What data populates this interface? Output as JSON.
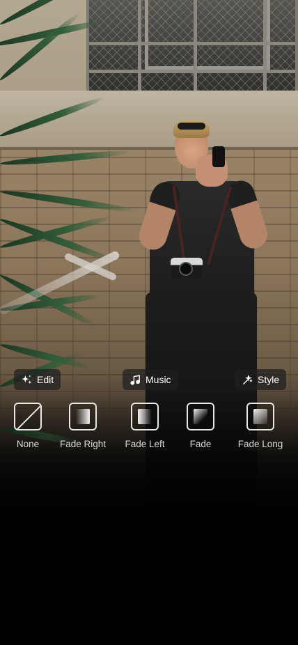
{
  "toolbar": {
    "edit": {
      "label": "Edit",
      "icon": "sparkle-icon"
    },
    "music": {
      "label": "Music",
      "icon": "music-note-icon"
    },
    "style": {
      "label": "Style",
      "icon": "magic-wand-icon"
    }
  },
  "transitions": [
    {
      "label": "None",
      "icon": "none-slash-icon"
    },
    {
      "label": "Fade Right",
      "icon": "fade-right-icon"
    },
    {
      "label": "Fade Left",
      "icon": "fade-left-icon"
    },
    {
      "label": "Fade",
      "icon": "fade-icon"
    },
    {
      "label": "Fade Long",
      "icon": "fade-long-icon"
    }
  ],
  "colors": {
    "chip_background": "#1e1e1e",
    "swatch_border": "#e8e8e8",
    "label_text": "#dcdcdc",
    "page_background": "#000000"
  }
}
